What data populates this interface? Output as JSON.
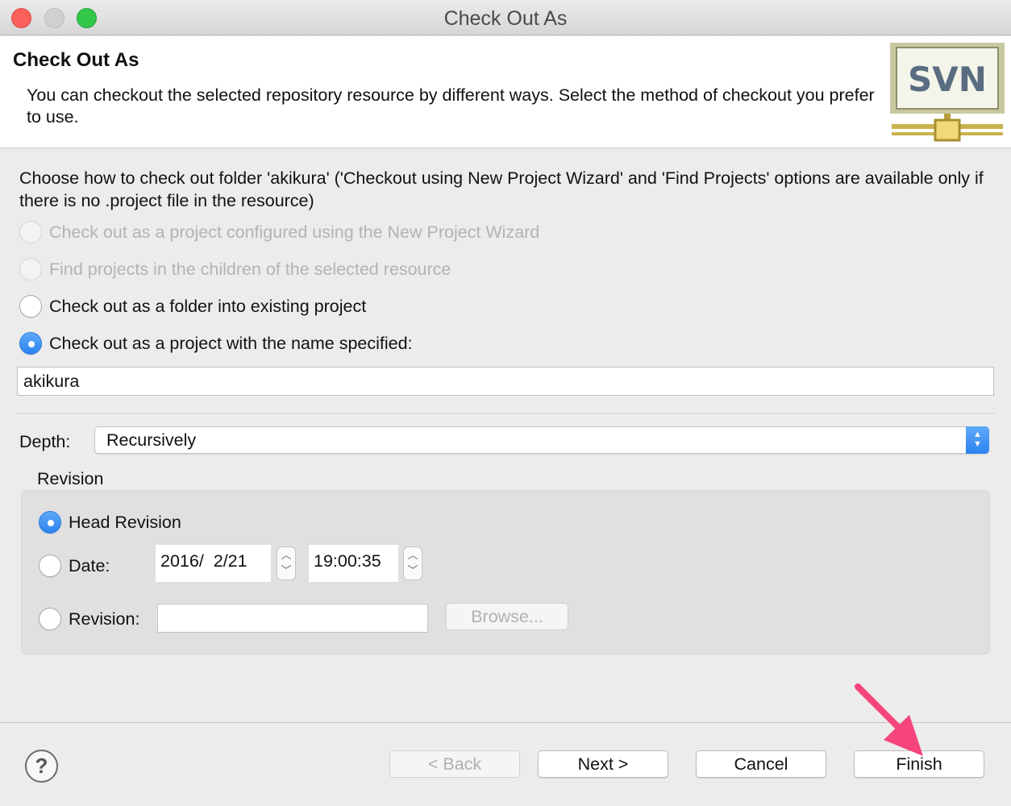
{
  "window": {
    "title": "Check Out As"
  },
  "banner": {
    "title": "Check Out As",
    "description": "You can checkout the selected repository resource by different ways. Select the method of checkout you prefer to use.",
    "logo_text": "SVN"
  },
  "main": {
    "instruction": "Choose how to check out folder 'akikura' ('Checkout using New Project Wizard' and 'Find Projects' options are available only if there is no .project file in the resource)",
    "options": [
      {
        "label": "Check out as a project configured using the New Project Wizard",
        "enabled": false,
        "selected": false
      },
      {
        "label": "Find projects in the children of the selected resource",
        "enabled": false,
        "selected": false
      },
      {
        "label": "Check out as a folder into existing project",
        "enabled": true,
        "selected": false
      },
      {
        "label": "Check out as a project with the name specified:",
        "enabled": true,
        "selected": true
      }
    ],
    "project_name": "akikura",
    "depth": {
      "label": "Depth:",
      "value": "Recursively"
    },
    "revision": {
      "group_label": "Revision",
      "head_label": "Head Revision",
      "date_label": "Date:",
      "date_value": "2016/  2/21",
      "time_value": "19:00:35",
      "revision_label": "Revision:",
      "revision_value": "",
      "browse_label": "Browse...",
      "selected": "head"
    }
  },
  "footer": {
    "help_symbol": "?",
    "back_label": "< Back",
    "next_label": "Next >",
    "cancel_label": "Cancel",
    "finish_label": "Finish"
  },
  "colors": {
    "accent_blue": "#2c83f0",
    "annotation_arrow": "#f5457a"
  }
}
